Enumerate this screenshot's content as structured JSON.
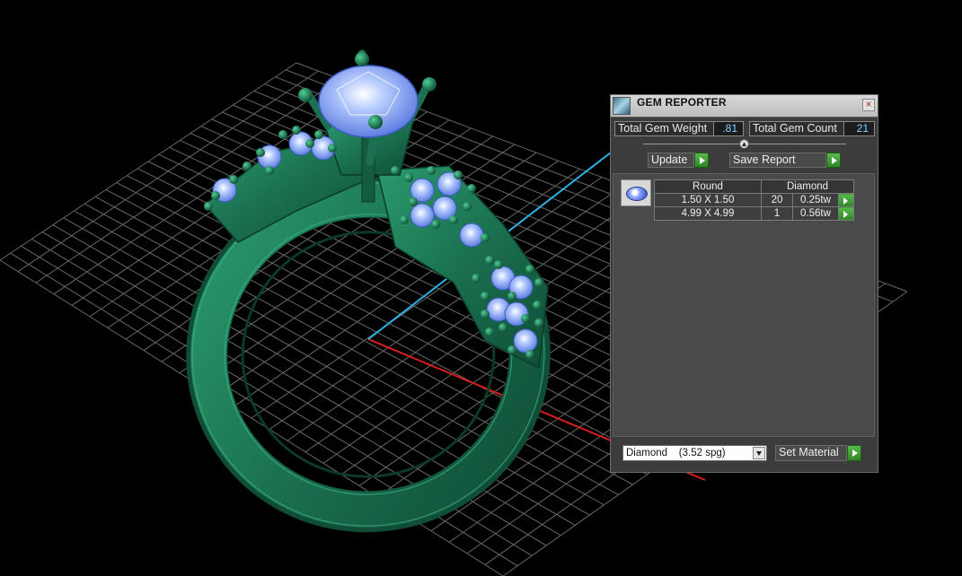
{
  "panel": {
    "title": "GEM REPORTER",
    "close_label": "×",
    "total_weight_label": "Total Gem Weight",
    "total_weight_value": ".81",
    "total_count_label": "Total Gem Count",
    "total_count_value": "21",
    "update_label": "Update",
    "save_report_label": "Save Report",
    "table": {
      "headers": [
        "Round",
        "Diamond"
      ],
      "rows": [
        {
          "size": "1.50 X 1.50",
          "count": "20",
          "weight": "0.25tw"
        },
        {
          "size": "4.99 X 4.99",
          "count": "1",
          "weight": "0.56tw"
        }
      ]
    },
    "material_select_value": "Diamond    (3.52 spg)",
    "set_material_label": "Set Material"
  },
  "colors": {
    "background": "#000000",
    "ring_metal": "#1f7a55",
    "gem": "#8eb4ff",
    "grid": "#7a7a7a",
    "axis_x": "#d81e1e",
    "axis_y": "#2bb4e8",
    "button_green": "#3fa034"
  }
}
